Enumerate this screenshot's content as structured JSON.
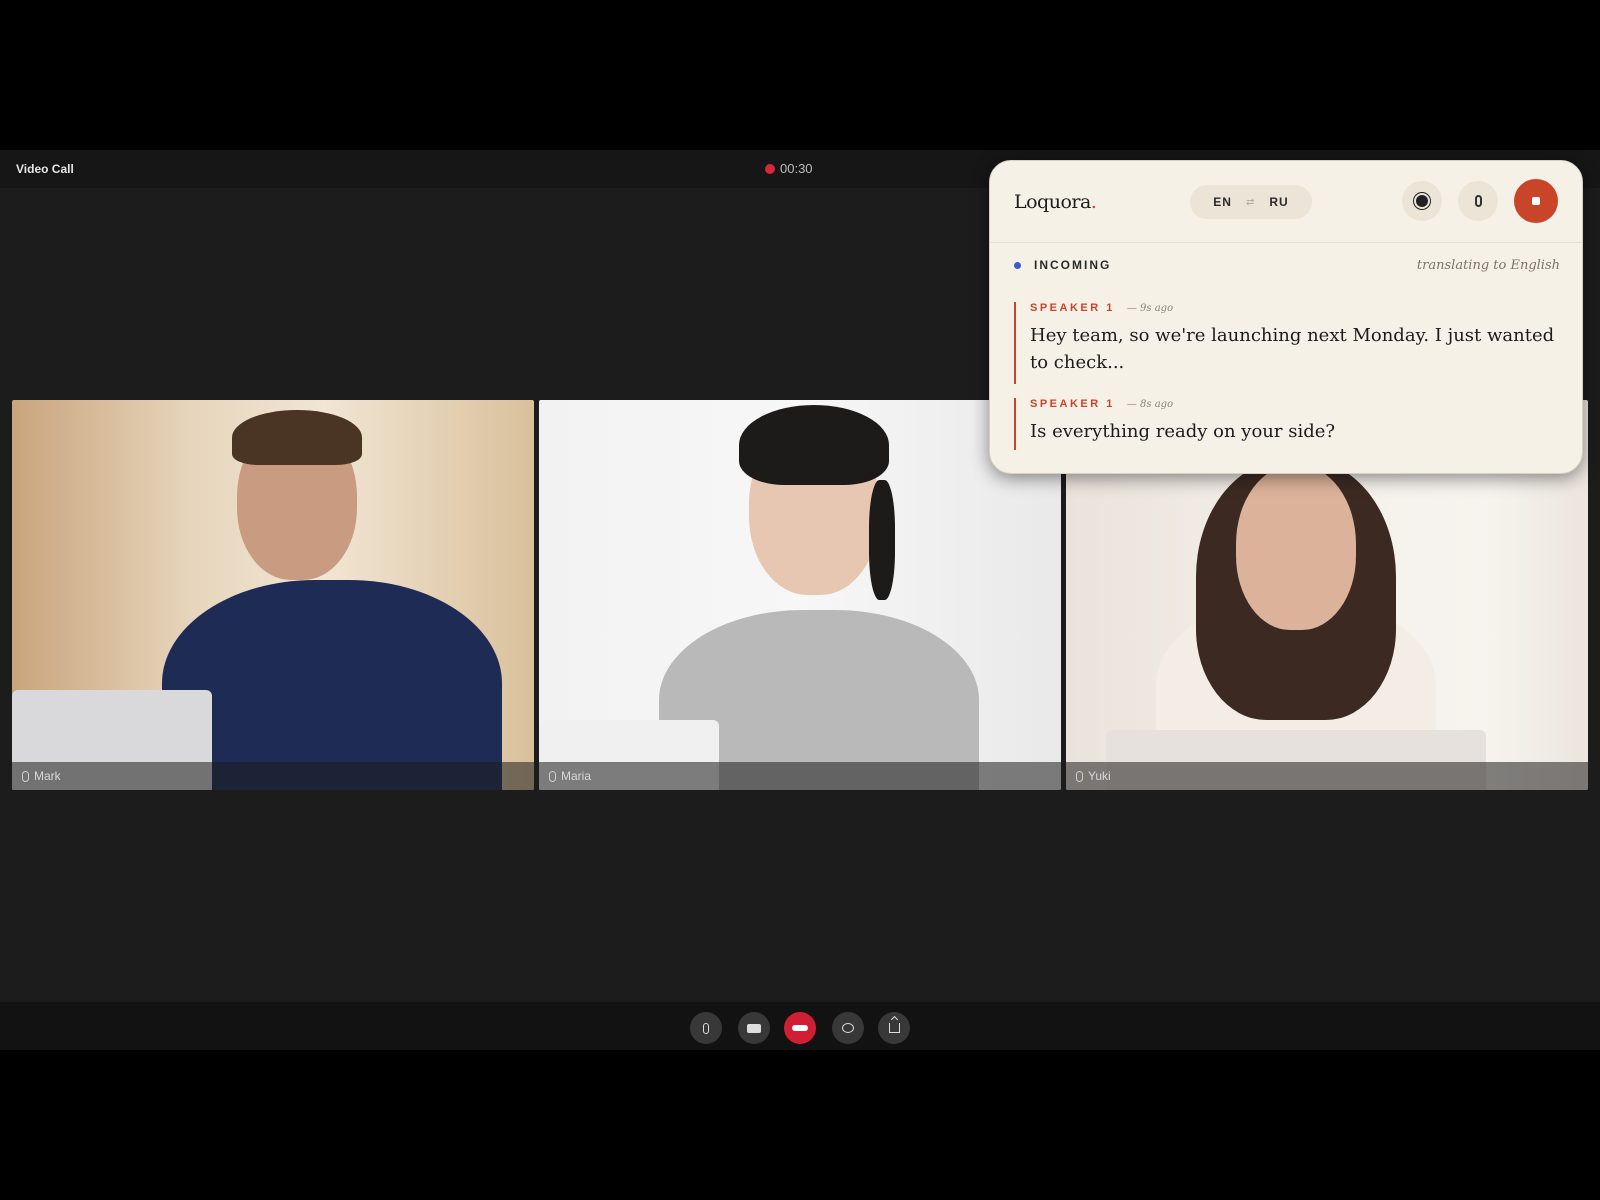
{
  "call": {
    "title": "Video Call",
    "timer": "00:30"
  },
  "participants": [
    {
      "name": "Mark"
    },
    {
      "name": "Maria"
    },
    {
      "name": "Yuki"
    }
  ],
  "translator": {
    "brand": "Loquora",
    "brand_dot": ".",
    "lang_from": "EN",
    "lang_swap": "⇄",
    "lang_to": "RU",
    "section_label": "INCOMING",
    "section_note": "translating to English",
    "entries": [
      {
        "speaker": "SPEAKER 1",
        "ago": "— 9s ago",
        "text": "Hey team, so we're launching next Monday. I just wanted to check..."
      },
      {
        "speaker": "SPEAKER 1",
        "ago": "— 8s ago",
        "text": "Is everything ready on your side?"
      }
    ],
    "colors": {
      "accent": "#c8452a",
      "incoming": "#3b5bd6",
      "panel": "#f6f1e7"
    }
  },
  "controls": [
    "microphone-icon",
    "camera-icon",
    "end-call-icon",
    "chat-icon",
    "share-screen-icon"
  ],
  "colors": {
    "end_call": "#d01f34",
    "recording": "#d5263a"
  }
}
